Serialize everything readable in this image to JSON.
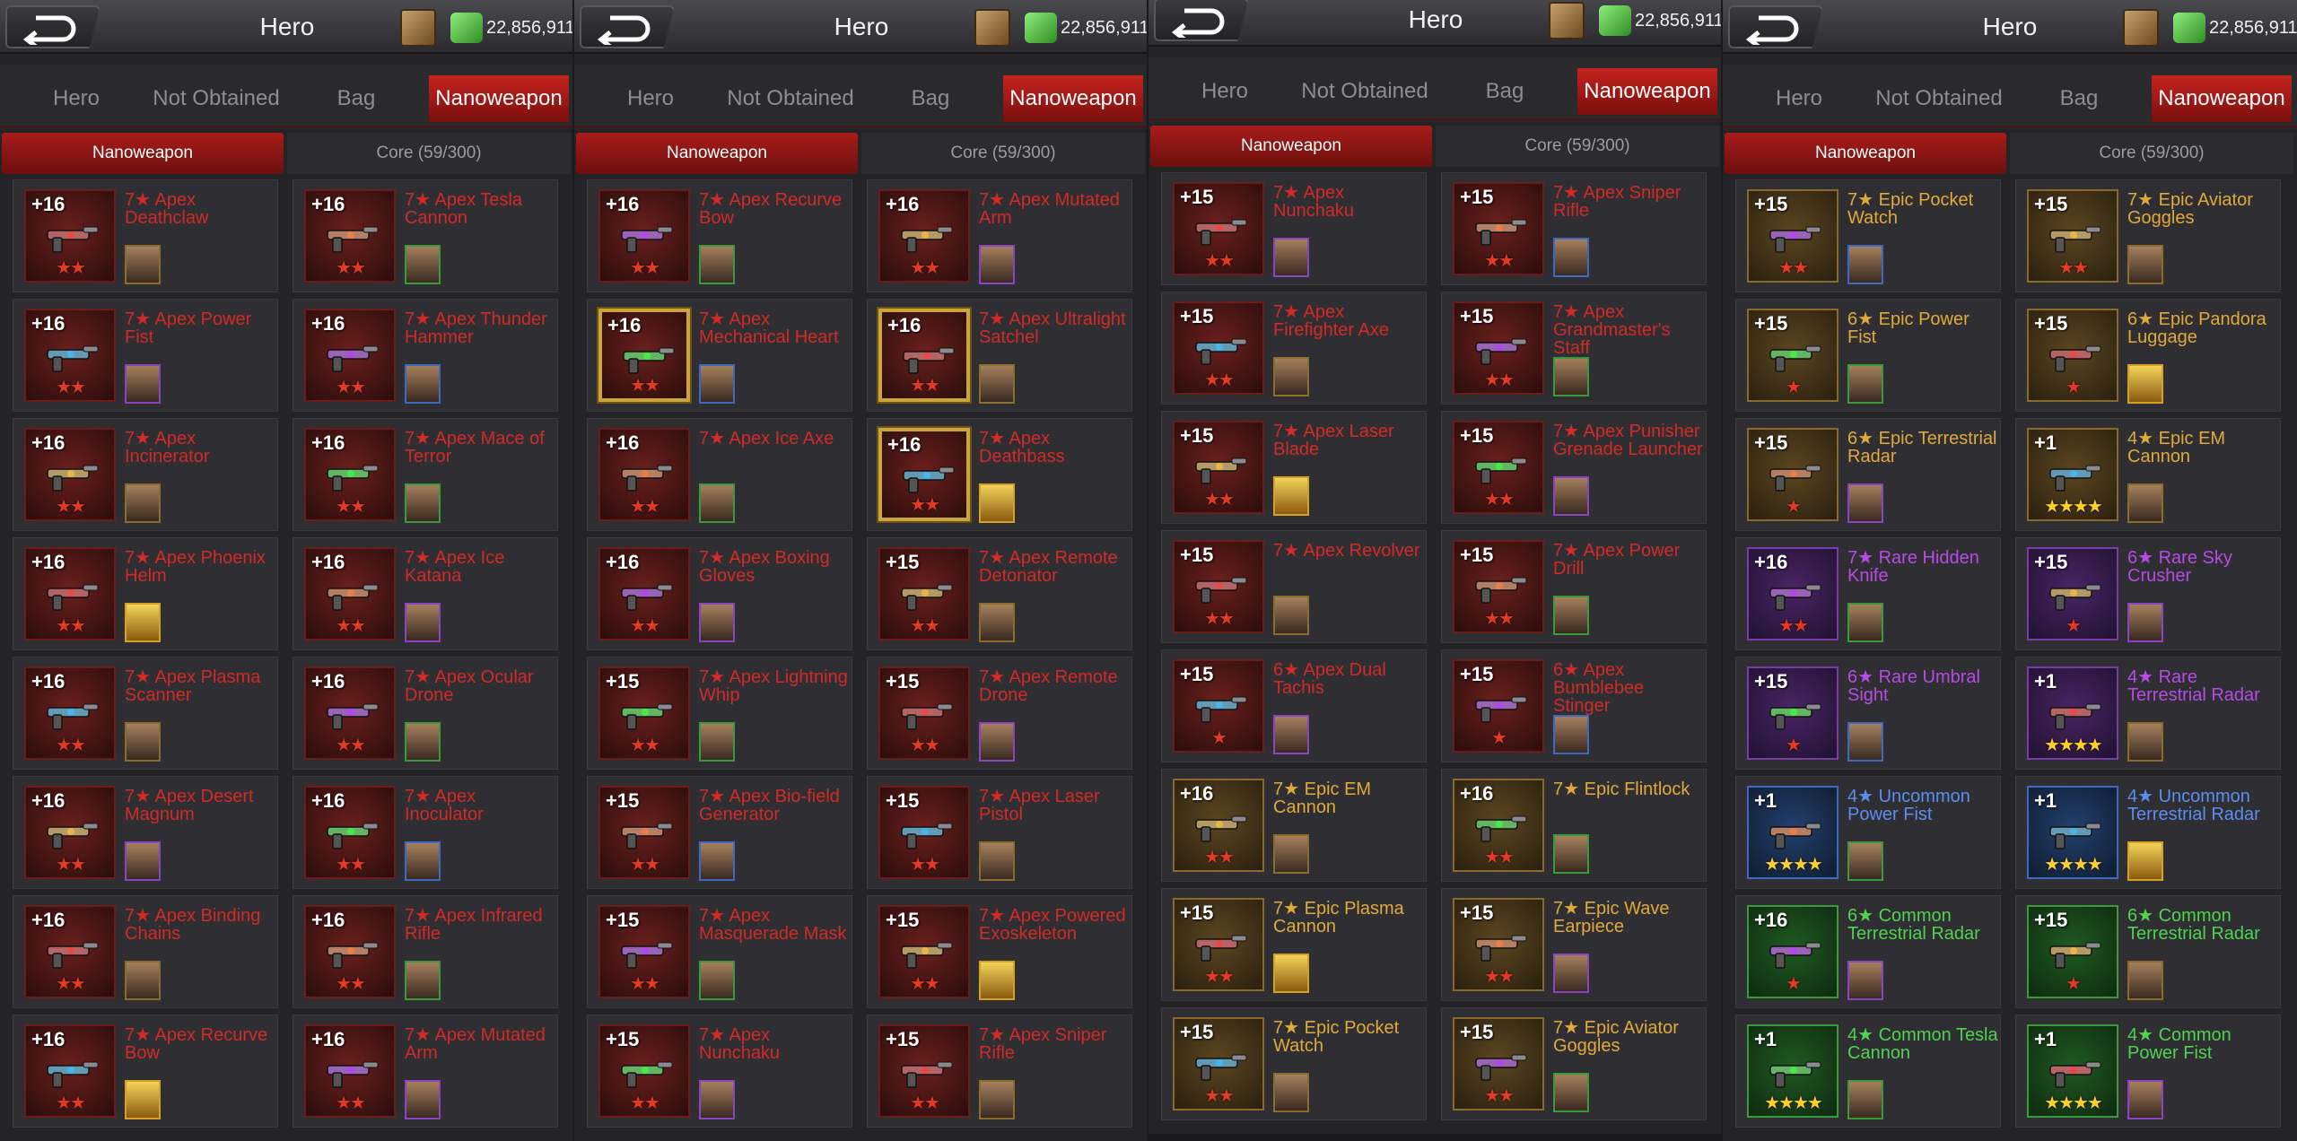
{
  "header": {
    "title": "Hero",
    "currency": "22,856,911"
  },
  "tabs": [
    "Hero",
    "Not Obtained",
    "Bag",
    "Nanoweapon"
  ],
  "subtabs": [
    "Nanoweapon",
    "Core (59/300)"
  ],
  "colors": {
    "apex": "#d32a26",
    "epic": "#e1a93a",
    "rare": "#b84ae6",
    "uncommon": "#5a8ef0",
    "common": "#4fd34f",
    "active_tab": "#c5231f"
  },
  "panels": [
    {
      "cards": [
        {
          "level": "+16",
          "name": "7★ Apex Deathclaw",
          "stars": "★★",
          "rarity": "apex"
        },
        {
          "level": "+16",
          "name": "7★ Apex Tesla Cannon",
          "stars": "★★",
          "rarity": "apex"
        },
        {
          "level": "+16",
          "name": "7★ Apex Power Fist",
          "stars": "★★",
          "rarity": "apex"
        },
        {
          "level": "+16",
          "name": "7★ Apex Thunder Hammer",
          "stars": "★★",
          "rarity": "apex"
        },
        {
          "level": "+16",
          "name": "7★ Apex Incinerator",
          "stars": "★★",
          "rarity": "apex"
        },
        {
          "level": "+16",
          "name": "7★ Apex Mace of Terror",
          "stars": "★★",
          "rarity": "apex"
        },
        {
          "level": "+16",
          "name": "7★ Apex Phoenix Helm",
          "stars": "★★",
          "rarity": "apex"
        },
        {
          "level": "+16",
          "name": "7★ Apex Ice Katana",
          "stars": "★★",
          "rarity": "apex"
        },
        {
          "level": "+16",
          "name": "7★ Apex Plasma Scanner",
          "stars": "★★",
          "rarity": "apex"
        },
        {
          "level": "+16",
          "name": "7★ Apex Ocular Drone",
          "stars": "★★",
          "rarity": "apex"
        },
        {
          "level": "+16",
          "name": "7★ Apex Desert Magnum",
          "stars": "★★",
          "rarity": "apex"
        },
        {
          "level": "+16",
          "name": "7★ Apex Inoculator",
          "stars": "★★",
          "rarity": "apex"
        },
        {
          "level": "+16",
          "name": "7★ Apex Binding Chains",
          "stars": "★★",
          "rarity": "apex"
        },
        {
          "level": "+16",
          "name": "7★ Apex Infrared Rifle",
          "stars": "★★",
          "rarity": "apex"
        },
        {
          "level": "+16",
          "name": "7★ Apex Recurve Bow",
          "stars": "★★",
          "rarity": "apex"
        },
        {
          "level": "+16",
          "name": "7★ Apex Mutated Arm",
          "stars": "★★",
          "rarity": "apex"
        }
      ]
    },
    {
      "cards": [
        {
          "level": "+16",
          "name": "7★ Apex Recurve Bow",
          "stars": "★★",
          "rarity": "apex"
        },
        {
          "level": "+16",
          "name": "7★ Apex Mutated Arm",
          "stars": "★★",
          "rarity": "apex"
        },
        {
          "level": "+16",
          "name": "7★ Apex Mechanical Heart",
          "stars": "★★",
          "rarity": "apex",
          "gold": true
        },
        {
          "level": "+16",
          "name": "7★ Apex Ultralight Satchel",
          "stars": "★★",
          "rarity": "apex",
          "gold": true
        },
        {
          "level": "+16",
          "name": "7★ Apex Ice Axe",
          "stars": "★★",
          "rarity": "apex"
        },
        {
          "level": "+16",
          "name": "7★ Apex Deathbass",
          "stars": "★★",
          "rarity": "apex",
          "gold": true
        },
        {
          "level": "+16",
          "name": "7★ Apex Boxing Gloves",
          "stars": "★★",
          "rarity": "apex"
        },
        {
          "level": "+15",
          "name": "7★ Apex Remote Detonator",
          "stars": "★★",
          "rarity": "apex"
        },
        {
          "level": "+15",
          "name": "7★ Apex Lightning Whip",
          "stars": "★★",
          "rarity": "apex"
        },
        {
          "level": "+15",
          "name": "7★ Apex Remote Drone",
          "stars": "★★",
          "rarity": "apex"
        },
        {
          "level": "+15",
          "name": "7★ Apex Bio-field Generator",
          "stars": "★★",
          "rarity": "apex"
        },
        {
          "level": "+15",
          "name": "7★ Apex Laser Pistol",
          "stars": "★★",
          "rarity": "apex"
        },
        {
          "level": "+15",
          "name": "7★ Apex Masquerade Mask",
          "stars": "★★",
          "rarity": "apex"
        },
        {
          "level": "+15",
          "name": "7★ Apex Powered Exoskeleton",
          "stars": "★★",
          "rarity": "apex"
        },
        {
          "level": "+15",
          "name": "7★ Apex Nunchaku",
          "stars": "★★",
          "rarity": "apex"
        },
        {
          "level": "+15",
          "name": "7★ Apex Sniper Rifle",
          "stars": "★★",
          "rarity": "apex"
        }
      ]
    },
    {
      "cards": [
        {
          "level": "+15",
          "name": "7★ Apex Nunchaku",
          "stars": "★★",
          "rarity": "apex"
        },
        {
          "level": "+15",
          "name": "7★ Apex Sniper Rifle",
          "stars": "★★",
          "rarity": "apex"
        },
        {
          "level": "+15",
          "name": "7★ Apex Firefighter Axe",
          "stars": "★★",
          "rarity": "apex"
        },
        {
          "level": "+15",
          "name": "7★ Apex Grandmaster's Staff",
          "stars": "★★",
          "rarity": "apex"
        },
        {
          "level": "+15",
          "name": "7★ Apex Laser Blade",
          "stars": "★★",
          "rarity": "apex"
        },
        {
          "level": "+15",
          "name": "7★ Apex Punisher Grenade Launcher",
          "stars": "★★",
          "rarity": "apex"
        },
        {
          "level": "+15",
          "name": "7★ Apex Revolver",
          "stars": "★★",
          "rarity": "apex"
        },
        {
          "level": "+15",
          "name": "7★ Apex Power Drill",
          "stars": "★★",
          "rarity": "apex"
        },
        {
          "level": "+15",
          "name": "6★ Apex Dual Tachis",
          "stars": "★",
          "rarity": "apex"
        },
        {
          "level": "+15",
          "name": "6★ Apex Bumblebee Stinger",
          "stars": "★",
          "rarity": "apex"
        },
        {
          "level": "+16",
          "name": "7★ Epic EM Cannon",
          "stars": "★★",
          "rarity": "epic"
        },
        {
          "level": "+16",
          "name": "7★ Epic Flintlock",
          "stars": "★★",
          "rarity": "epic"
        },
        {
          "level": "+15",
          "name": "7★ Epic Plasma Cannon",
          "stars": "★★",
          "rarity": "epic"
        },
        {
          "level": "+15",
          "name": "7★ Epic Wave Earpiece",
          "stars": "★★",
          "rarity": "epic"
        },
        {
          "level": "+15",
          "name": "7★ Epic Pocket Watch",
          "stars": "★★",
          "rarity": "epic"
        },
        {
          "level": "+15",
          "name": "7★ Epic Aviator Goggles",
          "stars": "★★",
          "rarity": "epic"
        }
      ]
    },
    {
      "cards": [
        {
          "level": "+15",
          "name": "7★ Epic Pocket Watch",
          "stars": "★★",
          "rarity": "epic"
        },
        {
          "level": "+15",
          "name": "7★ Epic Aviator Goggles",
          "stars": "★★",
          "rarity": "epic"
        },
        {
          "level": "+15",
          "name": "6★ Epic Power Fist",
          "stars": "★",
          "rarity": "epic"
        },
        {
          "level": "+15",
          "name": "6★ Epic Pandora Luggage",
          "stars": "★",
          "rarity": "epic"
        },
        {
          "level": "+15",
          "name": "6★ Epic Terrestrial Radar",
          "stars": "★",
          "rarity": "epic"
        },
        {
          "level": "+1",
          "name": "4★ Epic EM Cannon",
          "stars": "★★★★",
          "rarity": "epic"
        },
        {
          "level": "+16",
          "name": "7★ Rare Hidden Knife",
          "stars": "★★",
          "rarity": "rare"
        },
        {
          "level": "+15",
          "name": "6★ Rare Sky Crusher",
          "stars": "★",
          "rarity": "rare"
        },
        {
          "level": "+15",
          "name": "6★ Rare Umbral Sight",
          "stars": "★",
          "rarity": "rare"
        },
        {
          "level": "+1",
          "name": "4★ Rare Terrestrial Radar",
          "stars": "★★★★",
          "rarity": "rare"
        },
        {
          "level": "+1",
          "name": "4★ Uncommon Power Fist",
          "stars": "★★★★",
          "rarity": "unc"
        },
        {
          "level": "+1",
          "name": "4★ Uncommon Terrestrial Radar",
          "stars": "★★★★",
          "rarity": "unc"
        },
        {
          "level": "+16",
          "name": "6★ Common Terrestrial Radar",
          "stars": "★",
          "rarity": "com"
        },
        {
          "level": "+15",
          "name": "6★ Common Terrestrial Radar",
          "stars": "★",
          "rarity": "com"
        },
        {
          "level": "+1",
          "name": "4★ Common Tesla Cannon",
          "stars": "★★★★",
          "rarity": "com"
        },
        {
          "level": "+1",
          "name": "4★ Common Power Fist",
          "stars": "★★★★",
          "rarity": "com"
        }
      ]
    }
  ]
}
